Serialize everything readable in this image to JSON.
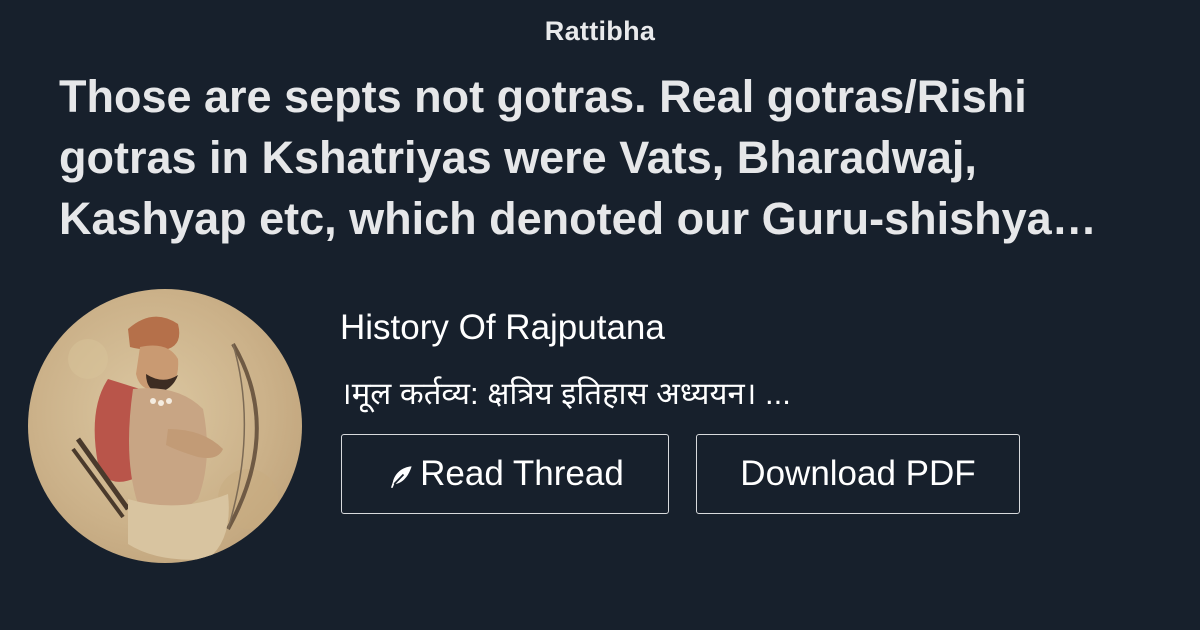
{
  "brand": "Rattibha",
  "thread": {
    "title": "Those are septs not gotras. Real gotras/Rishi gotras in Kshatriyas were Vats, Bharadwaj, Kashyap etc, which denoted our Guru-shishya parampara"
  },
  "author": {
    "name": "History Of Rajputana",
    "bio": "।मूल कर्तव्य: क्षत्रिय इतिहास अध्ययन। ...",
    "avatar_icon": "avatar-portrait-painting"
  },
  "actions": {
    "read_label": "Read Thread",
    "read_icon": "feather-icon",
    "pdf_label": "Download PDF"
  },
  "colors": {
    "background": "#17202c",
    "text": "#ffffff",
    "button_border": "#d8dadd"
  }
}
